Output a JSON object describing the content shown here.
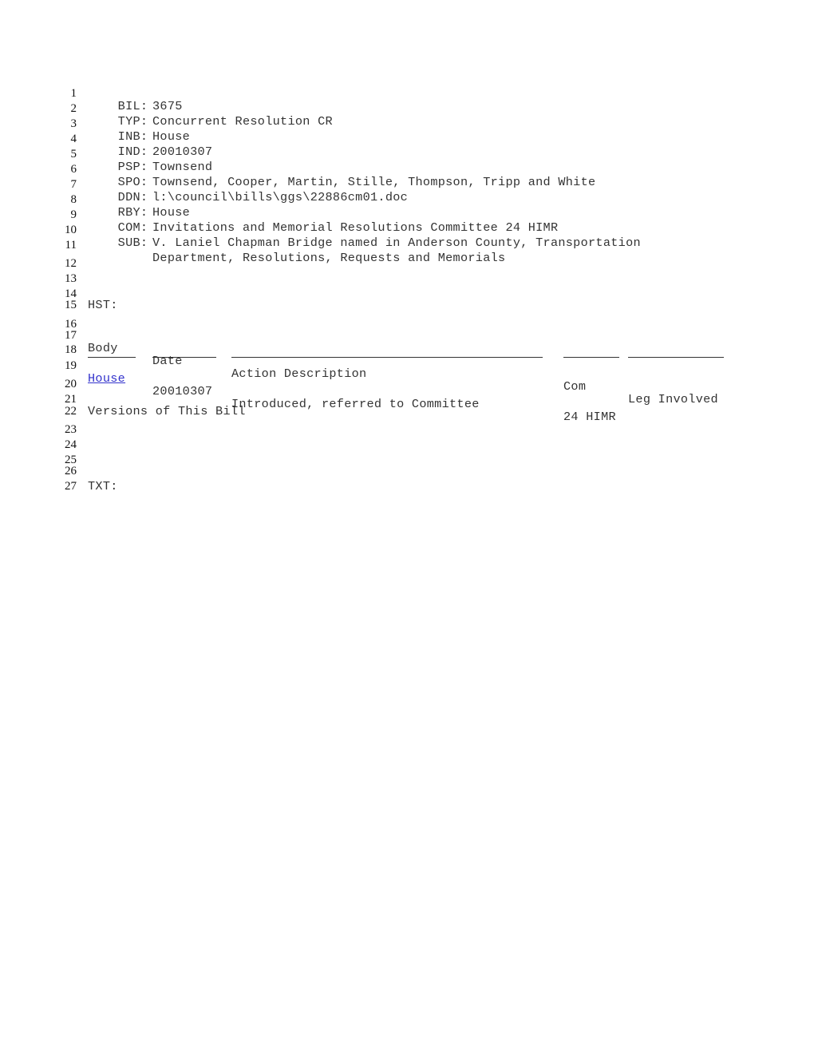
{
  "document": {
    "line_numbers": [
      "1",
      "2",
      "3",
      "4",
      "5",
      "6",
      "7",
      "8",
      "9",
      "10",
      "11",
      "12",
      "13",
      "14",
      "15",
      "16",
      "17",
      "18",
      "19",
      "20",
      "21",
      "22",
      "23",
      "24",
      "25",
      "26",
      "27"
    ],
    "fields": [
      {
        "label": "BIL:",
        "value": "3675"
      },
      {
        "label": "TYP:",
        "value": "Concurrent Resolution CR"
      },
      {
        "label": "INB:",
        "value": "House"
      },
      {
        "label": "IND:",
        "value": "20010307"
      },
      {
        "label": "PSP:",
        "value": "Townsend"
      },
      {
        "label": "SPO:",
        "value": "Townsend, Cooper, Martin, Stille, Thompson, Tripp and White"
      },
      {
        "label": "DDN:",
        "value": "l:\\council\\bills\\ggs\\22886cm01.doc"
      },
      {
        "label": "RBY:",
        "value": "House"
      },
      {
        "label": "COM:",
        "value": "Invitations and Memorial Resolutions Committee 24 HIMR"
      },
      {
        "label": "SUB:",
        "value": "V. Laniel Chapman Bridge named in Anderson County, Transportation"
      },
      {
        "label": "",
        "value": "Department, Resolutions, Requests and Memorials"
      }
    ],
    "history_label": "HST:",
    "history_table": {
      "headers": {
        "body": "Body",
        "date": "Date",
        "action": "Action Description",
        "com": "Com",
        "leg": "Leg Involved"
      },
      "rows": [
        {
          "body": "House",
          "date": "20010307",
          "action": "Introduced, referred to Committee",
          "com": "24 HIMR",
          "leg": ""
        }
      ]
    },
    "versions_label": "Versions of This Bill",
    "text_label": "TXT:",
    "colors": {
      "link": "#3333cc",
      "text": "#333333"
    }
  }
}
